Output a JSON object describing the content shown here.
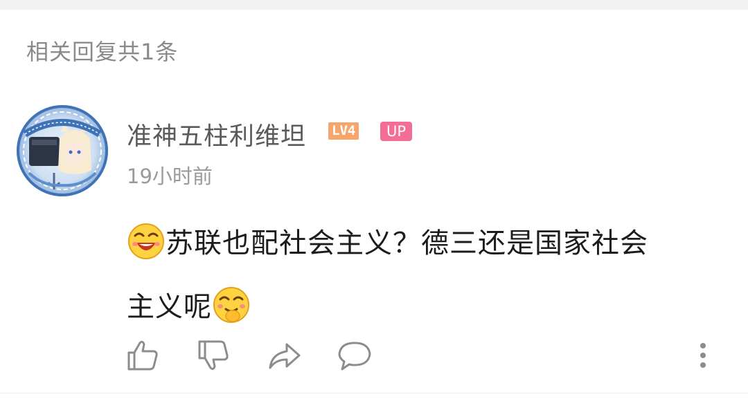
{
  "section": {
    "title": "相关回复共1条"
  },
  "comment": {
    "author": "准神五柱利维坦",
    "level_badge": "LV4",
    "up_badge": "UP",
    "time": "19小时前",
    "text_line1": "苏联也配社会主义？德三还是国家社会",
    "text_line2": "主义呢",
    "avatar_icon": "anime-avatar-icon",
    "emoji_1": "laughing-emoji-icon",
    "emoji_2": "snicker-emoji-icon"
  },
  "actions": {
    "like_icon": "thumbs-up-icon",
    "dislike_icon": "thumbs-down-icon",
    "share_icon": "share-icon",
    "reply_icon": "comment-bubble-icon",
    "more_icon": "more-vertical-icon"
  },
  "colors": {
    "accent_level": "#f6a56b",
    "accent_up": "#f36d96",
    "text_primary": "#1c1c1c",
    "text_secondary": "#9a9a9a"
  }
}
